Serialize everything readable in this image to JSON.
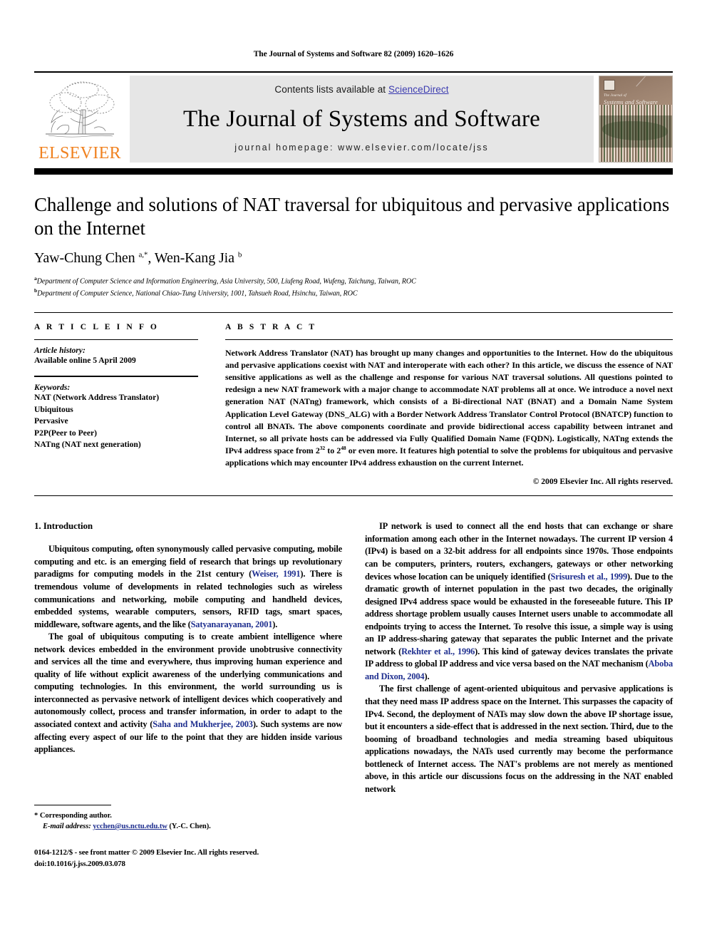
{
  "running_head": "The Journal of Systems and Software 82 (2009) 1620–1626",
  "masthead": {
    "publisher_wordmark": "ELSEVIER",
    "contents_prefix": "Contents lists available at ",
    "contents_link": "ScienceDirect",
    "journal_title": "The Journal of Systems and Software",
    "homepage": "journal homepage: www.elsevier.com/locate/jss",
    "cover_title_small": "The Journal of",
    "cover_title_big": "Systems and Software",
    "accent_orange": "#F08221",
    "link_blue": "#3b3bb0",
    "panel_grey": "#e6e6e6"
  },
  "article": {
    "title": "Challenge and solutions of NAT traversal for ubiquitous and pervasive applications on the Internet",
    "authors_plain": "Yaw-Chung Chen a,*, Wen-Kang Jia b",
    "affiliation_a": "Department of Computer Science and Information Engineering, Asia University, 500, Liufeng Road, Wufeng, Taichung, Taiwan, ROC",
    "affiliation_b": "Department of Computer Science, National Chiao-Tung University, 1001, Tahsueh Road, Hsinchu, Taiwan, ROC"
  },
  "article_info": {
    "heading": "A R T I C L E  I N F O",
    "history_label": "Article history:",
    "history_value": "Available online 5 April 2009",
    "keywords_label": "Keywords:",
    "keywords": [
      "NAT (Network Address Translator)",
      "Ubiquitous",
      "Pervasive",
      "P2P(Peer to Peer)",
      "NATng (NAT next generation)"
    ]
  },
  "abstract": {
    "heading": "A B S T R A C T",
    "text_part1": "Network Address Translator (NAT) has brought up many changes and opportunities to the Internet. How do the ubiquitous and pervasive applications coexist with NAT and interoperate with each other? In this article, we discuss the essence of NAT sensitive applications as well as the challenge and response for various NAT traversal solutions. All questions pointed to redesign a new NAT framework with a major change to accommodate NAT problems all at once. We introduce a novel next generation NAT (NATng) framework, which consists of a Bi-directional NAT (BNAT) and a Domain Name System Application Level Gateway (DNS_ALG) with a Border Network Address Translator Control Protocol (BNATCP) function to control all BNATs. The above components coordinate and provide bidirectional access capability between intranet and Internet, so all private hosts can be addressed via Fully Qualified Domain Name (FQDN). Logistically, NATng extends the IPv4 address space from 2",
    "exp1": "32",
    "text_part2": " to 2",
    "exp2": "48",
    "text_part3": " or even more. It features high potential to solve the problems for ubiquitous and pervasive applications which may encounter IPv4 address exhaustion on the current Internet.",
    "copyright": "© 2009 Elsevier Inc. All rights reserved."
  },
  "body": {
    "section_number_title": "1. Introduction",
    "left_paragraphs": [
      {
        "runs": [
          {
            "t": "Ubiquitous computing, often synonymously called pervasive computing, mobile computing and etc. is an emerging field of research that brings up revolutionary paradigms for computing models in the 21st century (",
            "c": false
          },
          {
            "t": "Weiser, 1991",
            "c": true
          },
          {
            "t": "). There is tremendous volume of developments in related technologies such as wireless communications and networking, mobile computing and handheld devices, embedded systems, wearable computers, sensors, RFID tags, smart spaces, middleware, software agents, and the like (",
            "c": false
          },
          {
            "t": "Satyanarayanan, 2001",
            "c": true
          },
          {
            "t": ").",
            "c": false
          }
        ]
      },
      {
        "runs": [
          {
            "t": "The goal of ubiquitous computing is to create ambient intelligence where network devices embedded in the environment provide unobtrusive connectivity and services all the time and everywhere, thus improving human experience and quality of life without explicit awareness of the underlying communications and computing technologies. In this environment, the world surrounding us is interconnected as pervasive network of intelligent devices which cooperatively and autonomously collect, process and transfer information, in order to adapt to the associated context and activity (",
            "c": false
          },
          {
            "t": "Saha and Mukherjee, 2003",
            "c": true
          },
          {
            "t": "). Such systems are now affecting every aspect of our life to the point that they are hidden inside various appliances.",
            "c": false
          }
        ]
      }
    ],
    "right_paragraphs": [
      {
        "runs": [
          {
            "t": "IP network is used to connect all the end hosts that can exchange or share information among each other in the Internet nowadays. The current IP version 4 (IPv4) is based on a 32-bit address for all endpoints since 1970s. Those endpoints can be computers, printers, routers, exchangers, gateways or other networking devices whose location can be uniquely identified (",
            "c": false
          },
          {
            "t": "Srisuresh et al., 1999",
            "c": true
          },
          {
            "t": "). Due to the dramatic growth of internet population in the past two decades, the originally designed IPv4 address space would be exhausted in the foreseeable future. This IP address shortage problem usually causes Internet users unable to accommodate all endpoints trying to access the Internet. To resolve this issue, a simple way is using an IP address-sharing gateway that separates the public Internet and the private network (",
            "c": false
          },
          {
            "t": "Rekhter et al., 1996",
            "c": true
          },
          {
            "t": "). This kind of gateway devices translates the private IP address to global IP address and vice versa based on the NAT mechanism (",
            "c": false
          },
          {
            "t": "Aboba and Dixon, 2004",
            "c": true
          },
          {
            "t": ").",
            "c": false
          }
        ]
      },
      {
        "runs": [
          {
            "t": "The first challenge of agent-oriented ubiquitous and pervasive applications is that they need mass IP address space on the Internet. This surpasses the capacity of IPv4. Second, the deployment of NATs may slow down the above IP shortage issue, but it encounters a side-effect that is addressed in the next section. Third, due to the booming of broadband technologies and media streaming based ubiquitous applications nowadays, the NATs used currently may become the performance bottleneck of Internet access. The NAT's problems are not merely as mentioned above, in this article our discussions focus on the addressing in the NAT enabled network",
            "c": false
          }
        ]
      }
    ]
  },
  "footnote": {
    "star": "*",
    "corresponding": "Corresponding author.",
    "email_label": "E-mail address:",
    "email": "ycchen@us.nctu.edu.tw",
    "email_suffix": "(Y.-C. Chen).",
    "imprint_line1": "0164-1212/$ - see front matter © 2009 Elsevier Inc. All rights reserved.",
    "imprint_line2": "doi:10.1016/j.jss.2009.03.078"
  }
}
